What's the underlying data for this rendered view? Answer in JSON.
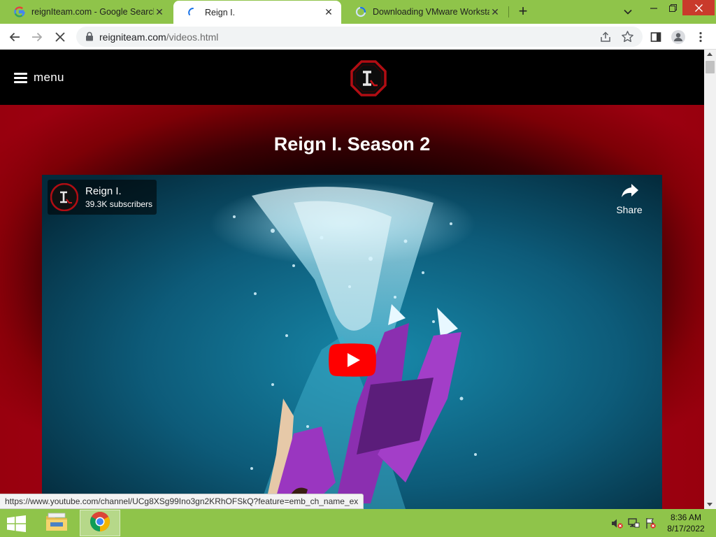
{
  "browser": {
    "tabs": [
      {
        "title": "reignIteam.com - Google Search",
        "favicon": "google-g-icon",
        "active": false
      },
      {
        "title": "Reign I.",
        "favicon": "loading-spinner-icon",
        "active": true
      },
      {
        "title": "Downloading VMware Workstatio",
        "favicon": "loading-spinner-icon",
        "active": false
      }
    ],
    "new_tab_symbol": "+",
    "address": {
      "host": "reigniteam.com",
      "path": "/videos.html"
    },
    "status_url": "https://www.youtube.com/channel/UCg8XSg99Ino3gn2KRhOFSkQ?feature=emb_ch_name_ex"
  },
  "site": {
    "menu_label": "menu",
    "page_title": "Reign I. Season 2"
  },
  "video": {
    "channel_name": "Reign I.",
    "channel_subscribers": "39.3K subscribers",
    "share_label": "Share"
  },
  "taskbar": {
    "time": "8:36 AM",
    "date": "8/17/2022",
    "pinned": [
      "file-explorer-icon",
      "chrome-icon"
    ]
  },
  "colors": {
    "tabstrip": "#8fc44a",
    "hero_red": "#9b0010",
    "youtube_red": "#ff0000"
  }
}
